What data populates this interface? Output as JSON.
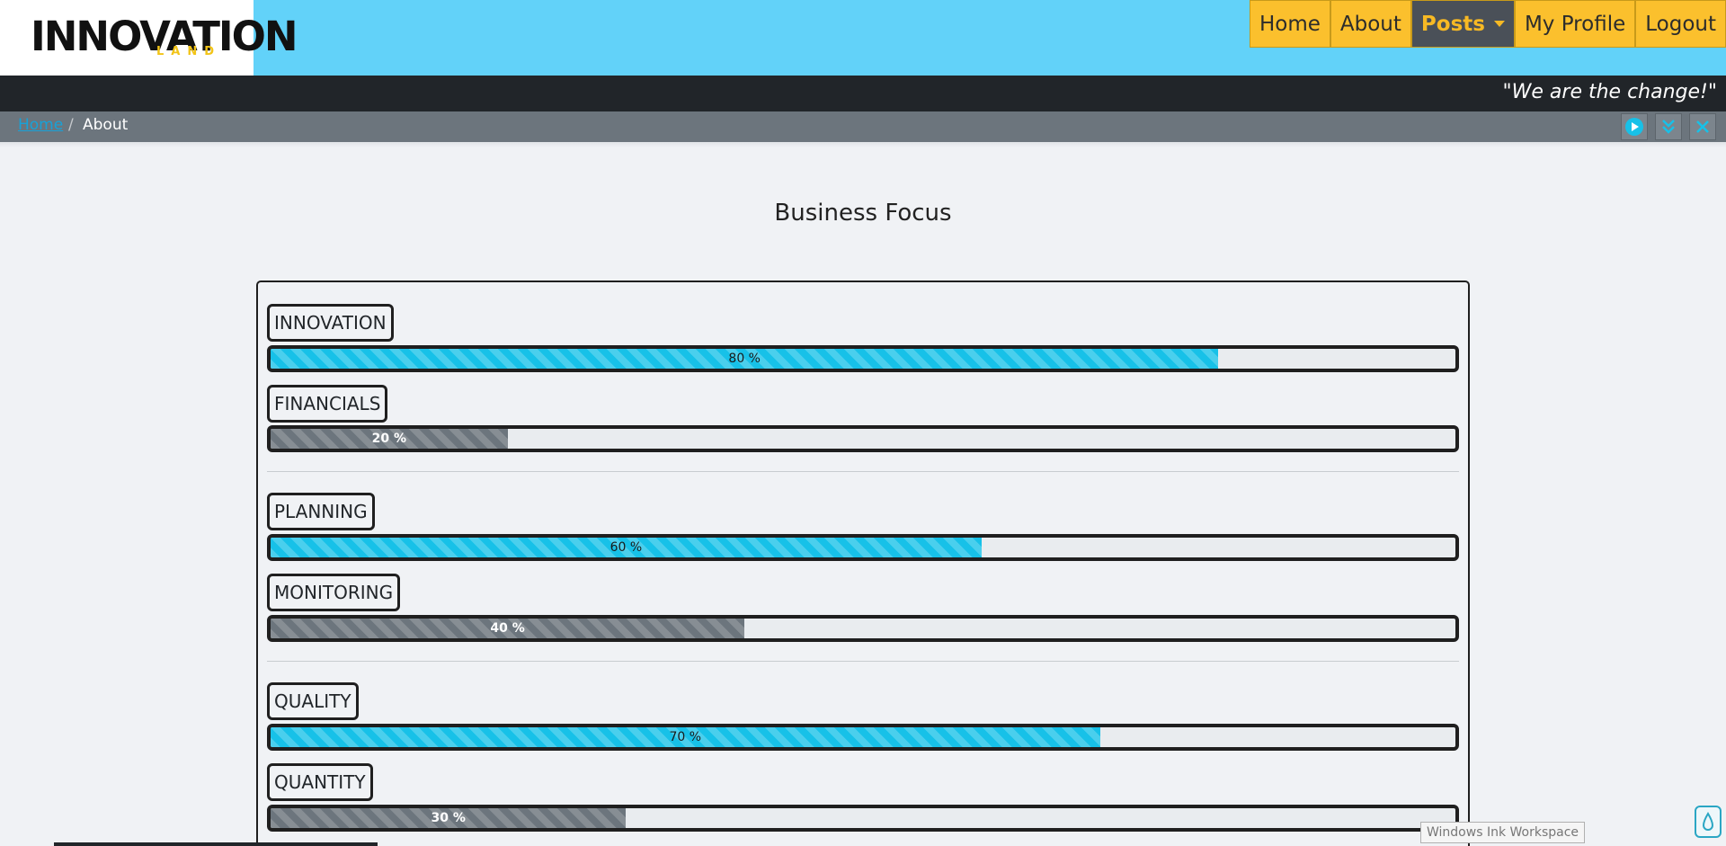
{
  "logo": {
    "main": "INNOVATION",
    "sub": "LAND"
  },
  "nav": {
    "items": [
      {
        "label": "Home",
        "active": false
      },
      {
        "label": "About",
        "active": false
      },
      {
        "label": "Posts",
        "active": true,
        "dropdown": true
      },
      {
        "label": "My Profile",
        "active": false
      },
      {
        "label": "Logout",
        "active": false
      }
    ]
  },
  "quote": "\"We are the change!\"",
  "breadcrumb": {
    "home": "Home",
    "separator": "/",
    "current": "About"
  },
  "controls": [
    "play-icon",
    "double-chevron-down-icon",
    "close-icon"
  ],
  "content": {
    "title": "Business Focus",
    "metrics": [
      {
        "label": "INNOVATION",
        "value": 80,
        "text": "80 %",
        "style": "info"
      },
      {
        "label": "FINANCIALS",
        "value": 20,
        "text": "20 %",
        "style": "secondary"
      },
      {
        "label": "PLANNING",
        "value": 60,
        "text": "60 %",
        "style": "info"
      },
      {
        "label": "MONITORING",
        "value": 40,
        "text": "40 %",
        "style": "secondary"
      },
      {
        "label": "QUALITY",
        "value": 70,
        "text": "70 %",
        "style": "info"
      },
      {
        "label": "QUANTITY",
        "value": 30,
        "text": "30 %",
        "style": "secondary"
      }
    ]
  },
  "tooltip": "Windows Ink Workspace",
  "colors": {
    "header": "#62d2f9",
    "nav": "#fbc02d",
    "info": "#17c1e8",
    "secondary": "#6c757d",
    "dark": "#212529"
  }
}
